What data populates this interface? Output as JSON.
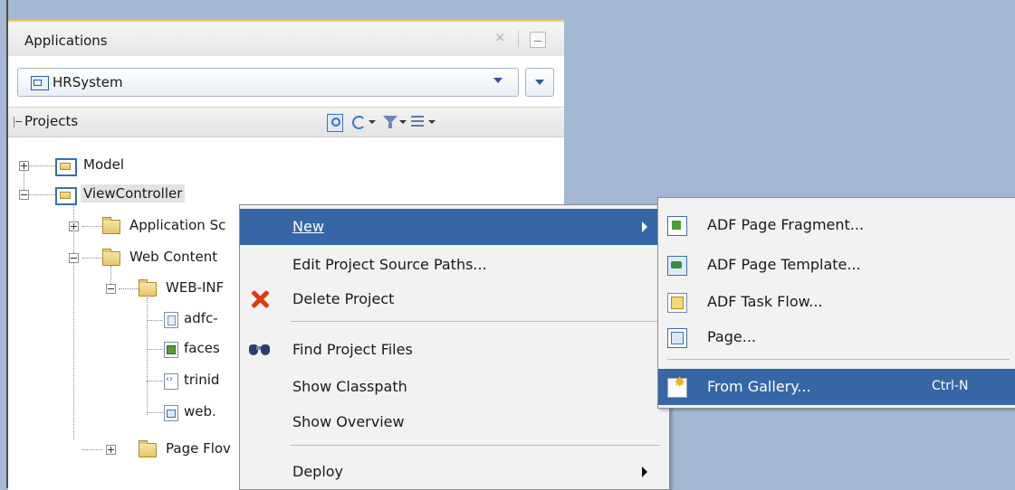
{
  "window": {
    "title": "Applications",
    "close_glyph": "×"
  },
  "application_selector": {
    "value": "HRSystem"
  },
  "projects_panel": {
    "label": "Projects"
  },
  "tree": {
    "model": "Model",
    "view_controller": "ViewController",
    "application_sources": "Application Sc",
    "web_content": "Web Content",
    "web_inf": "WEB-INF",
    "adfc": "adfc-",
    "faces": "faces",
    "trinidad": "trinid",
    "web": "web.",
    "page_flows": "Page Flov"
  },
  "context_menu": {
    "items": [
      {
        "label": "New",
        "mnemonic_index": 0,
        "has_submenu": true,
        "highlighted": true
      },
      {
        "label": "Edit Project Source Paths...",
        "has_submenu": false
      },
      {
        "label": "Delete Project",
        "icon": "delete-icon"
      },
      {
        "label": "Find Project Files",
        "icon": "binoculars-icon"
      },
      {
        "label": "Show Classpath"
      },
      {
        "label": "Show Overview"
      },
      {
        "label": "Deploy",
        "has_submenu": true
      }
    ]
  },
  "submenu": {
    "items": [
      {
        "label": "ADF Page Fragment...",
        "icon": "adf-page-fragment-icon"
      },
      {
        "label": "ADF Page Template...",
        "icon": "adf-page-template-icon"
      },
      {
        "label": "ADF Task Flow...",
        "icon": "adf-task-flow-icon"
      },
      {
        "label": "Page...",
        "icon": "page-icon"
      },
      {
        "label": "From Gallery...",
        "icon": "gallery-icon",
        "shortcut": "Ctrl-N",
        "highlighted": true
      }
    ]
  },
  "colors": {
    "background": "#a3b8d2",
    "highlight": "#3766a6",
    "panel_accent": "#f4c969",
    "delete_red": "#d83c12"
  }
}
